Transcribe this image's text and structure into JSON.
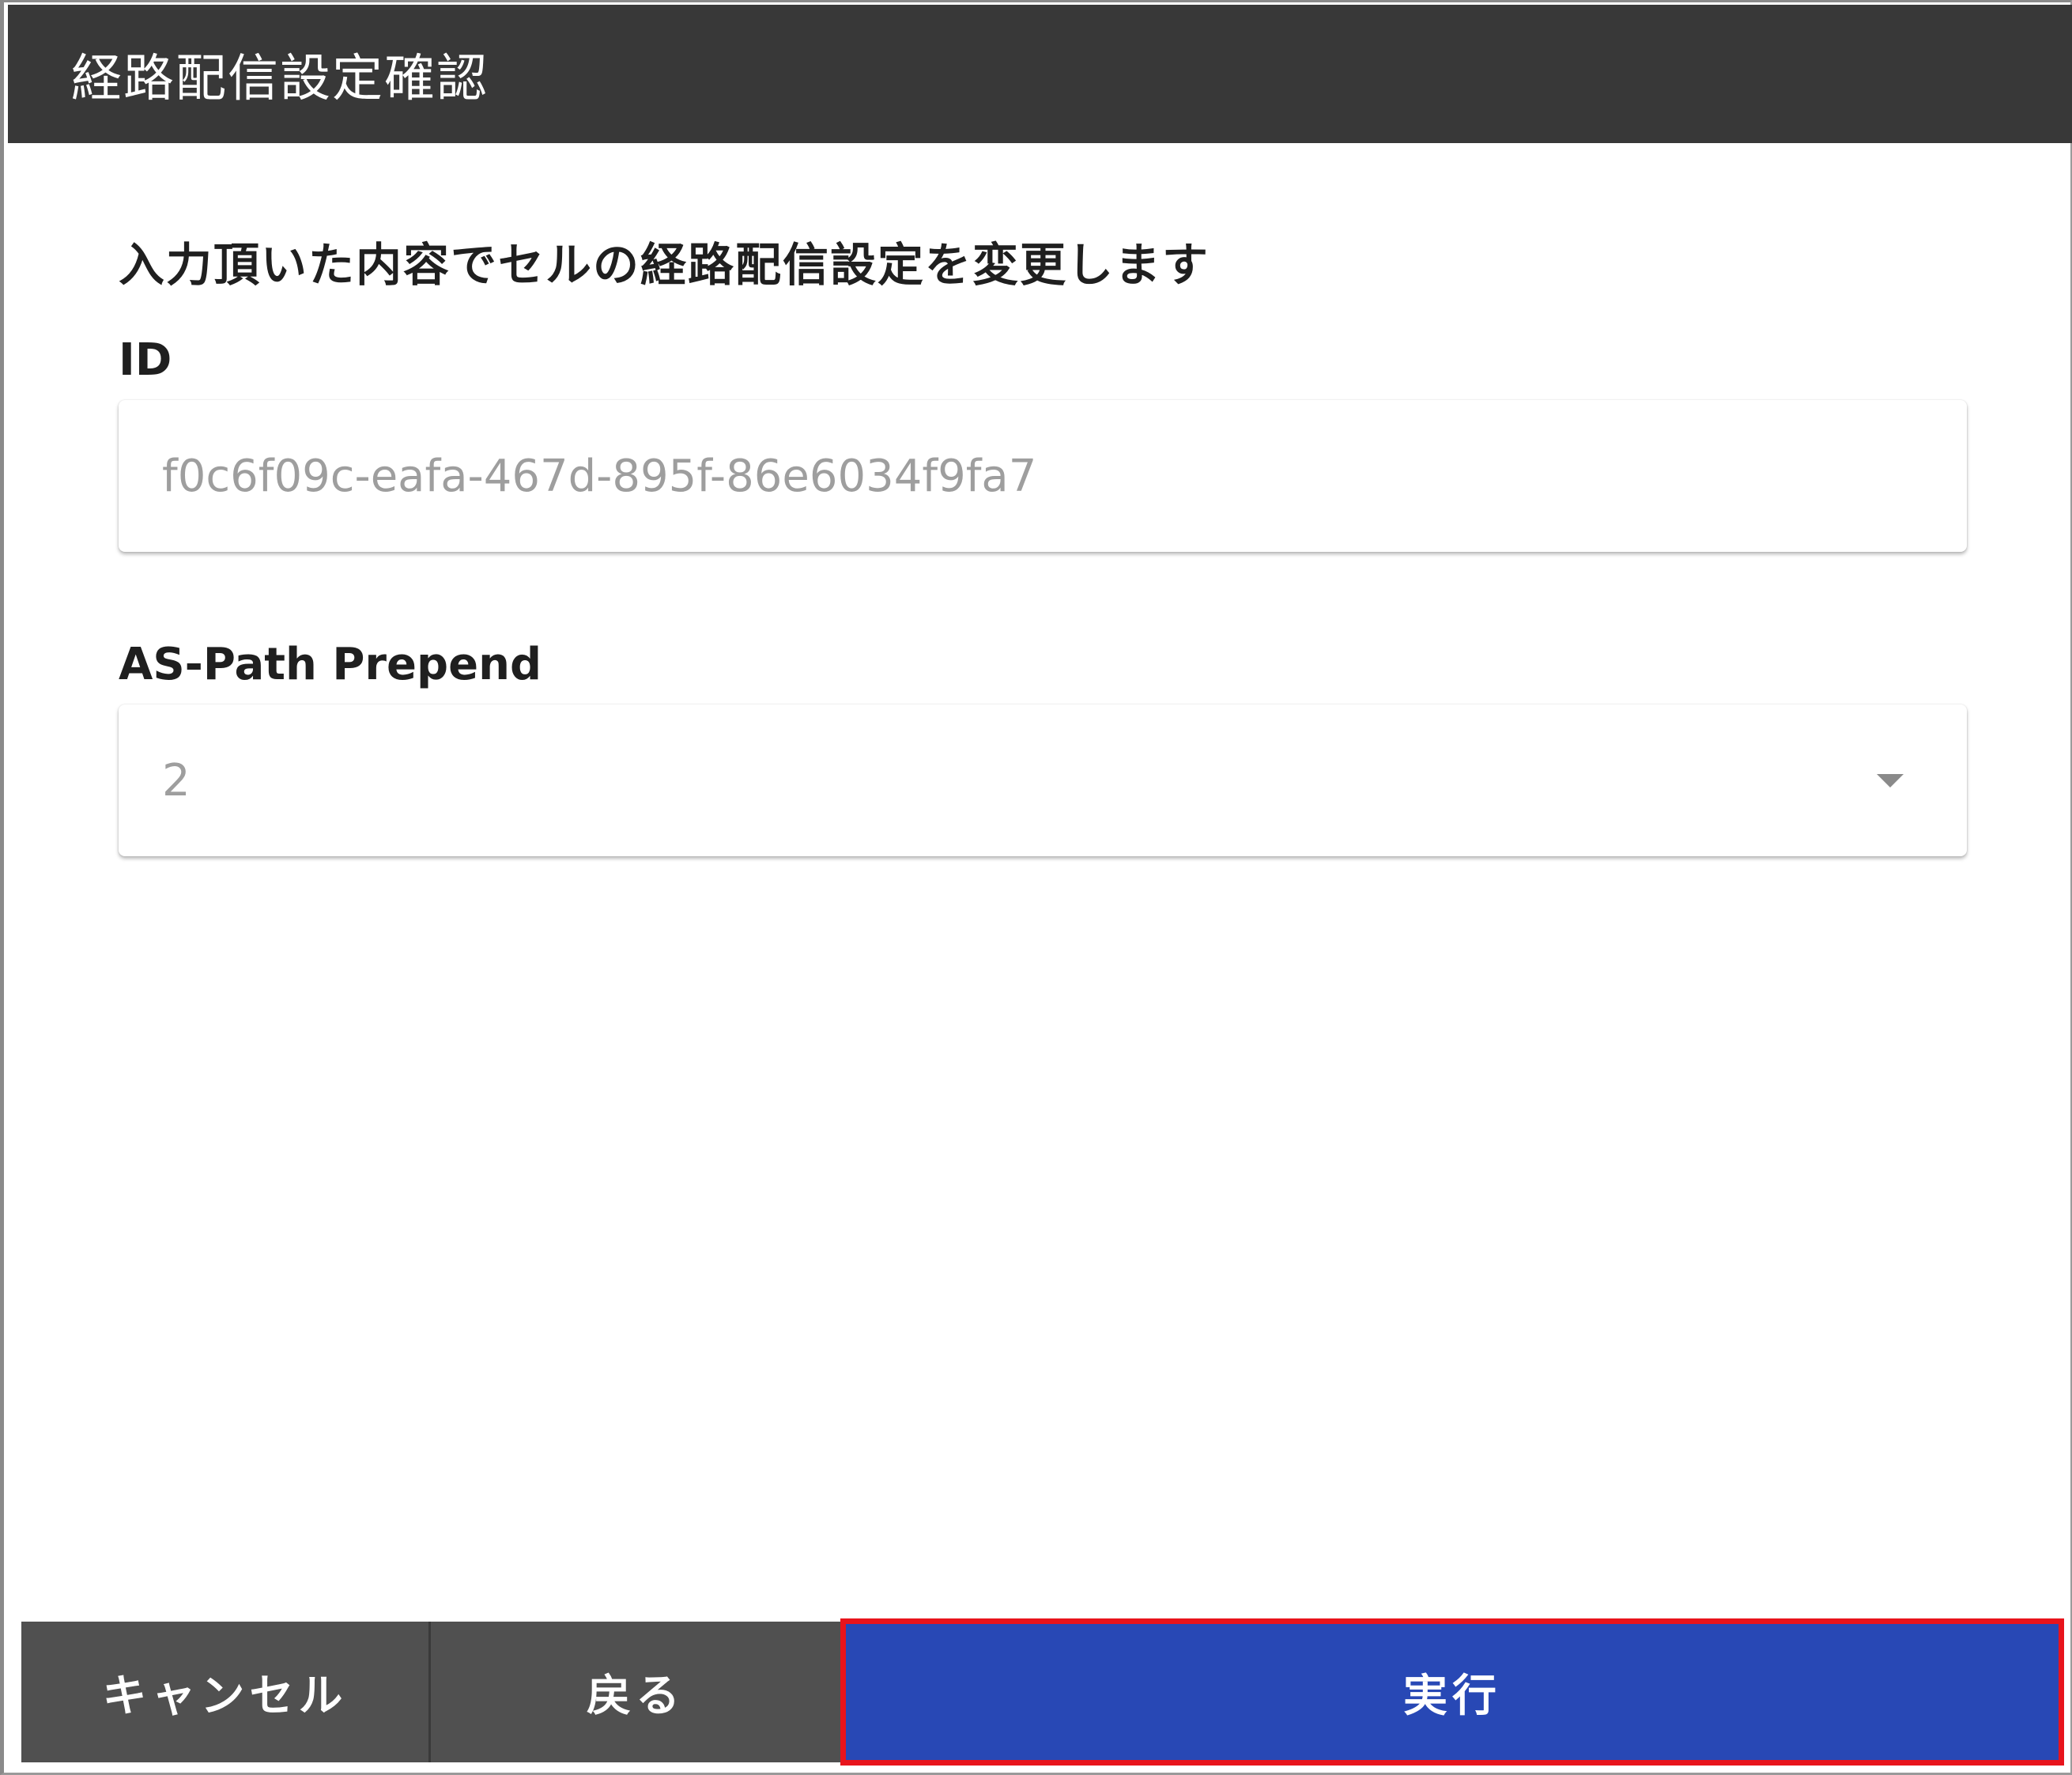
{
  "dialog": {
    "title": "経路配信設定確認",
    "message": "入力頂いた内容でセルの経路配信設定を変更します"
  },
  "fields": {
    "id": {
      "label": "ID",
      "value": "f0c6f09c-eafa-467d-895f-86e6034f9fa7"
    },
    "as_path_prepend": {
      "label": "AS-Path Prepend",
      "value": "2"
    }
  },
  "buttons": {
    "cancel": "キャンセル",
    "back": "戻る",
    "execute": "実行"
  },
  "colors": {
    "header_bg": "#383838",
    "secondary_button_bg": "#505050",
    "primary_button_bg": "#2848b5",
    "highlight_border": "#e8141c"
  },
  "icons": {
    "dropdown": "chevron-down-icon"
  }
}
